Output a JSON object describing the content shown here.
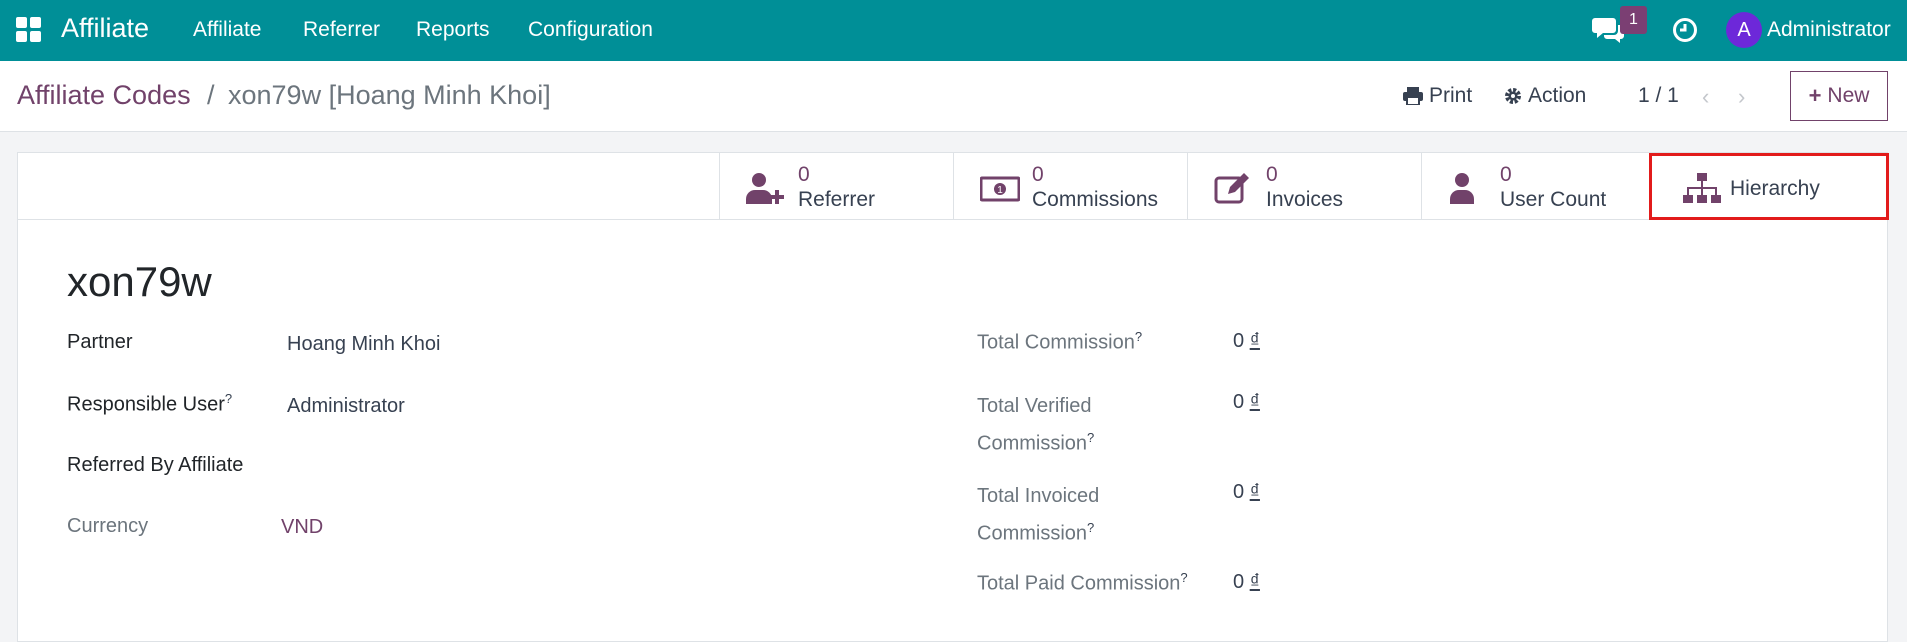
{
  "navbar": {
    "brand": "Affiliate",
    "menu": [
      "Affiliate",
      "Referrer",
      "Reports",
      "Configuration"
    ],
    "chat_badge": "1",
    "avatar_letter": "A",
    "user_name": "Administrator"
  },
  "control_panel": {
    "breadcrumb_parent": "Affiliate Codes",
    "breadcrumb_sep": "/",
    "breadcrumb_current": "xon79w [Hoang Minh Khoi]",
    "print_label": "Print",
    "action_label": "Action",
    "pager": "1 / 1",
    "prev_arrow": "‹",
    "next_arrow": "›",
    "new_label": "New"
  },
  "stat_buttons": [
    {
      "value": "0",
      "label": "Referrer",
      "icon": "user-plus-icon"
    },
    {
      "value": "0",
      "label": "Commissions",
      "icon": "money-icon"
    },
    {
      "value": "0",
      "label": "Invoices",
      "icon": "edit-icon"
    },
    {
      "value": "0",
      "label": "User Count",
      "icon": "user-icon"
    },
    {
      "label": "Hierarchy",
      "icon": "sitemap-icon"
    }
  ],
  "form": {
    "title": "xon79w",
    "partner_label": "Partner",
    "partner_value": "Hoang Minh Khoi",
    "responsible_label": "Responsible User",
    "responsible_value": "Administrator",
    "referred_label": "Referred By Affiliate",
    "currency_label": "Currency",
    "currency_value": "VND",
    "total_commission_label": "Total Commission",
    "total_verified_label_1": "Total Verified",
    "total_verified_label_2": "Commission",
    "total_invoiced_label_1": "Total Invoiced",
    "total_invoiced_label_2": "Commission",
    "total_paid_label": "Total Paid Commission",
    "amount": "0",
    "currency_symbol": "₫",
    "help_mark": "?"
  },
  "colors": {
    "navbar": "#008f97",
    "brand_purple": "#71426a",
    "highlight": "#e21b1b"
  }
}
